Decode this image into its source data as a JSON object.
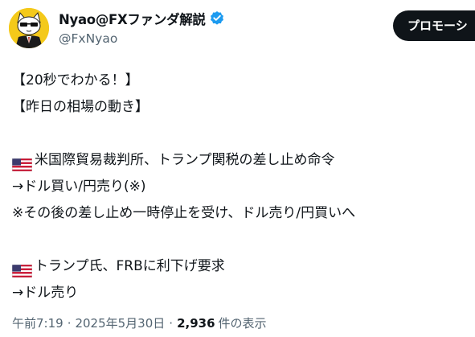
{
  "author": {
    "display_name": "Nyao@FXファンダ解説",
    "handle": "@FxNyao",
    "verified": true,
    "avatar_icon": "cat-in-suit-avatar"
  },
  "header": {
    "promote_label": "プロモーシ"
  },
  "tweet": {
    "lines": {
      "l1": "【20秒でわかる！】",
      "l2": "【昨日の相場の動き】",
      "l3": "米国際貿易裁判所、トランプ関税の差し止め命令",
      "l4": "→ドル買い/円売り(※)",
      "l5": "※その後の差し止め一時停止を受け、ドル売り/円買いへ",
      "l6": "トランプ氏、FRBに利下げ要求",
      "l7": "→ドル売り"
    },
    "flag_icon": "us-flag-emoji"
  },
  "meta": {
    "time": "午前7:19",
    "separator": "·",
    "date": "2025年5月30日",
    "views_count": "2,936",
    "views_label": "件の表示"
  },
  "colors": {
    "text": "#0f1419",
    "secondary": "#536471",
    "verified_blue": "#1d9bf0",
    "avatar_yellow": "#f4c91a",
    "button_bg": "#0f1419"
  }
}
